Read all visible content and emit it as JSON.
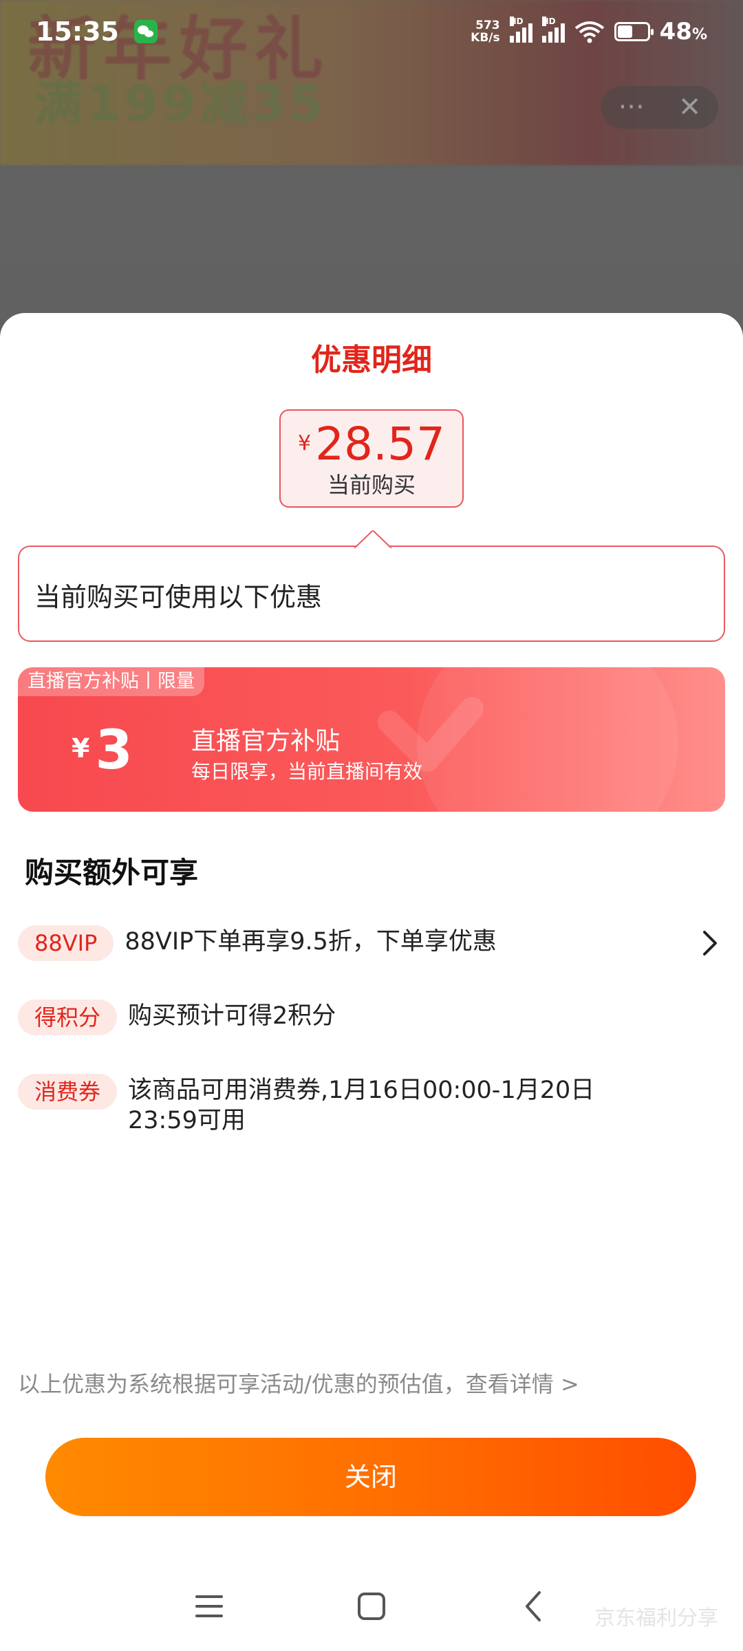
{
  "status_bar": {
    "time": "15:35",
    "net_speed_value": "573",
    "net_speed_unit": "KB/s",
    "sim1_label": "HD",
    "sim2_label": "HD",
    "battery_percent": "48",
    "battery_unit": "%",
    "icons": [
      "wechat-icon",
      "signal-icon",
      "wifi-icon",
      "battery-icon"
    ]
  },
  "background_page": {
    "banner_title": "新年好礼",
    "banner_subtitle": "满199减35",
    "more_label": "···",
    "close_label": "✕"
  },
  "sheet": {
    "title": "优惠明细",
    "price": {
      "currency": "¥",
      "amount": "28.57",
      "label": "当前购买"
    },
    "bubble_text": "当前购买可使用以下优惠",
    "coupon": {
      "tag": "直播官方补贴丨限量",
      "currency": "¥",
      "amount": "3",
      "title": "直播官方补贴",
      "description": "每日限享，当前直播间有效"
    },
    "extra_title": "购买额外可享",
    "extras": [
      {
        "tag": "88VIP",
        "text": "88VIP下单再享9.5折，下单享优惠",
        "has_arrow": true
      },
      {
        "tag": "得积分",
        "text": "购买预计可得2积分",
        "has_arrow": false
      },
      {
        "tag": "消费券",
        "text": "该商品可用消费券,1月16日00:00-1月20日 23:59可用",
        "has_arrow": false
      }
    ],
    "disclaimer": "以上优惠为系统根据可享活动/优惠的预估值，查看详情 >",
    "close_button": "关闭"
  },
  "nav_bar": {
    "icons": [
      "menu-icon",
      "home-icon",
      "back-icon"
    ],
    "watermark": "京东福利分享"
  },
  "colors": {
    "accent_red": "#e1251b",
    "coupon_gradient_start": "#f7494f",
    "coupon_gradient_end": "#ff8e8a",
    "close_button_gradient_start": "#ff8a00",
    "close_button_gradient_end": "#ff4d00",
    "tag_background": "#fde8e4"
  }
}
